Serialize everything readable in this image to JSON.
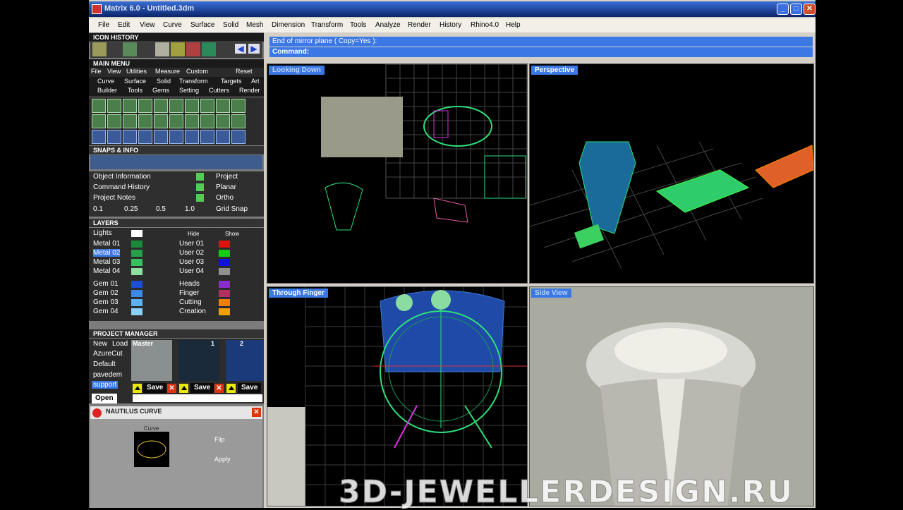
{
  "window": {
    "title": "Matrix 6.0 - Untitled.3dm"
  },
  "menus": [
    "File",
    "Edit",
    "View",
    "Curve",
    "Surface",
    "Solid",
    "Mesh",
    "Dimension",
    "Transform",
    "Tools",
    "Analyze",
    "Render",
    "History",
    "Rhino4.0",
    "Help"
  ],
  "icon_history": {
    "label": "ICON HISTORY"
  },
  "main_menu": {
    "label": "MAIN MENU",
    "links": [
      "File",
      "View",
      "Utilities",
      "Measure",
      "Custom"
    ],
    "reset": "Reset",
    "tabs_row1": [
      "Curve",
      "Surface",
      "Solid",
      "Transform",
      "Targets",
      "Art"
    ],
    "tabs_row2": [
      "Builder",
      "Tools",
      "Gems",
      "Setting",
      "Cutters",
      "Render"
    ]
  },
  "snaps": {
    "label": "SNAPS & INFO",
    "items_left": [
      "Object Information",
      "Command History",
      "Project Notes"
    ],
    "items_right": [
      "Project",
      "Planar",
      "Ortho"
    ],
    "steps": [
      "0.1",
      "0.25",
      "0.5",
      "1.0"
    ],
    "grid_snap": "Grid Snap"
  },
  "layers": {
    "label": "LAYERS",
    "lights": "Lights",
    "hide": "Hide",
    "show": "Show",
    "left": [
      {
        "name": "Metal 01",
        "color": "#1a8a3a"
      },
      {
        "name": "Metal 02",
        "color": "#26a04a"
      },
      {
        "name": "Metal 03",
        "color": "#36c060"
      },
      {
        "name": "Metal 04",
        "color": "#8de0a0"
      },
      {
        "name": "Gem 01",
        "color": "#1c4fd6"
      },
      {
        "name": "Gem 02",
        "color": "#3c8ae8"
      },
      {
        "name": "Gem 03",
        "color": "#5cb0f0"
      },
      {
        "name": "Gem 04",
        "color": "#8ad0f8"
      }
    ],
    "right": [
      {
        "name": "User 01",
        "color": "#e01010"
      },
      {
        "name": "User 02",
        "color": "#10d010"
      },
      {
        "name": "User 03",
        "color": "#1010e0"
      },
      {
        "name": "User 04",
        "color": "#909090"
      },
      {
        "name": "Heads",
        "color": "#8a2bd8"
      },
      {
        "name": "Finger",
        "color": "#b03060"
      },
      {
        "name": "Cutting",
        "color": "#f08000"
      },
      {
        "name": "Creation",
        "color": "#f0a000"
      }
    ]
  },
  "project_manager": {
    "label": "PROJECT MANAGER",
    "new": "New",
    "load": "Load",
    "files": [
      "AzureCut",
      "Default",
      "pavedem",
      "support"
    ],
    "master": "Master",
    "thumb1": "1",
    "thumb2": "2",
    "save": "Save",
    "open": "Open"
  },
  "nautilus": {
    "title": "NAUTILUS CURVE",
    "curve_label": "Curve",
    "flip": "Flip",
    "apply": "Apply"
  },
  "command": {
    "prompt": "End of mirror plane ( Copy=Yes ):",
    "label": "Command:"
  },
  "viewports": {
    "top_left": "Looking Down",
    "top_right": "Perspective",
    "bottom_left": "Through Finger",
    "bottom_right": "Side View"
  },
  "watermark": "3D-JEWELLERDESIGN.RU",
  "colors": {
    "accent": "#3b78e6",
    "wire_green": "#2ee07a",
    "grid": "#6a6a6a"
  }
}
